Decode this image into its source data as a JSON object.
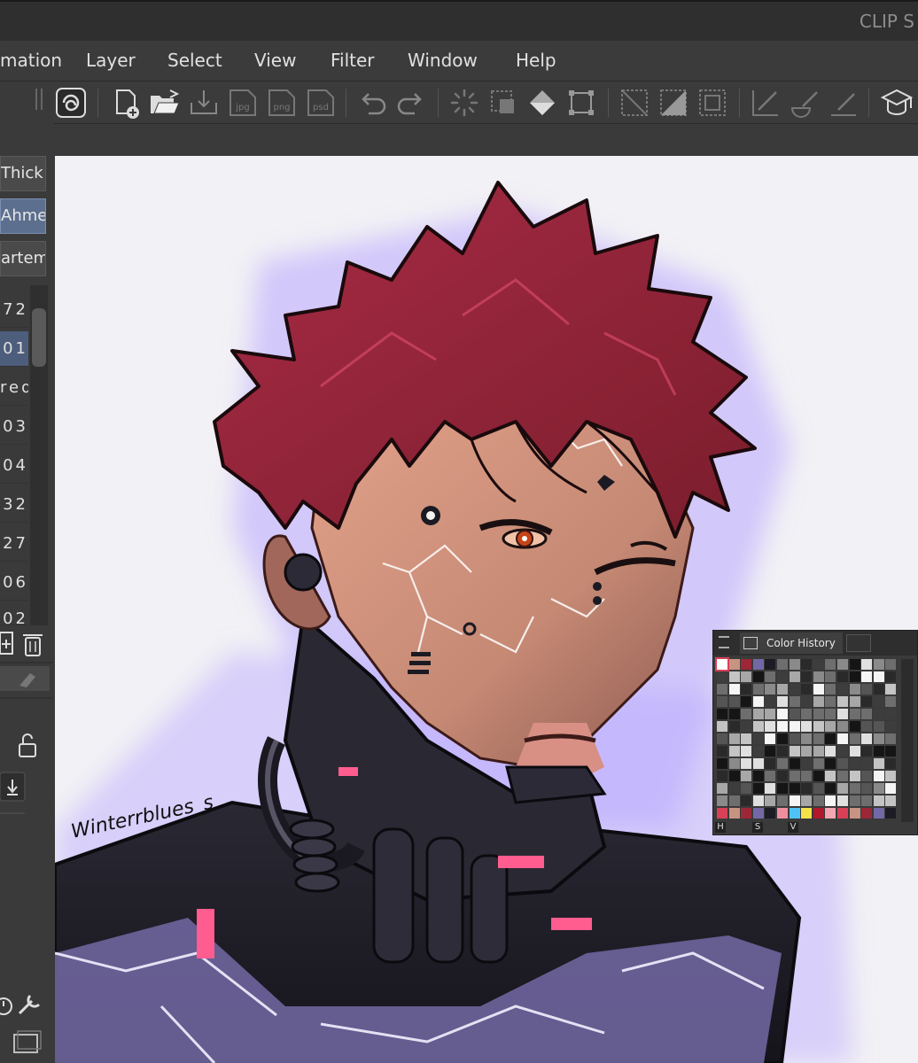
{
  "window": {
    "title": "CLIP S"
  },
  "menu": [
    {
      "label": "mation"
    },
    {
      "label": "Layer"
    },
    {
      "label": "Select"
    },
    {
      "label": "View"
    },
    {
      "label": "Filter"
    },
    {
      "label": "Window"
    },
    {
      "label": "Help"
    }
  ],
  "toolbar_icons": [
    "clip-logo-icon",
    "new-file-icon",
    "open-folder-icon",
    "save-icon",
    "export-jpg-icon",
    "export-png-icon",
    "export-psd-icon",
    "undo-icon",
    "redo-icon",
    "clear-icon",
    "selection-icon",
    "fill-icon",
    "transform-icon",
    "select-none-icon",
    "invert-selection-icon",
    "selection-border-icon",
    "ruler-icon",
    "brush-edit-icon",
    "line-edit-icon",
    "learn-icon"
  ],
  "toolbar_labels": {
    "jpg": "jpg",
    "png": "png",
    "psd": "psd"
  },
  "left_panel": {
    "presets": [
      {
        "label": "Thick",
        "selected": false
      },
      {
        "label": "Ahme",
        "selected": true
      },
      {
        "label": "artem",
        "selected": false
      }
    ],
    "rows": [
      {
        "label": "72",
        "selected": false
      },
      {
        "label": "01",
        "selected": true
      },
      {
        "label": "red",
        "selected": false
      },
      {
        "label": "03",
        "selected": false
      },
      {
        "label": "04",
        "selected": false
      },
      {
        "label": "32",
        "selected": false
      },
      {
        "label": "27",
        "selected": false
      },
      {
        "label": "06",
        "selected": false
      },
      {
        "label": "02",
        "selected": false
      }
    ]
  },
  "canvas": {
    "signature": "Winterrblues_s"
  },
  "color_history": {
    "title": "Color History",
    "footer": [
      "H",
      "S",
      "V"
    ],
    "colors": {
      "accent": "#d94057",
      "skin": "#c79482",
      "hair": "#9b2737",
      "purple": "#7368a5",
      "dark": "#1d1c25"
    }
  }
}
